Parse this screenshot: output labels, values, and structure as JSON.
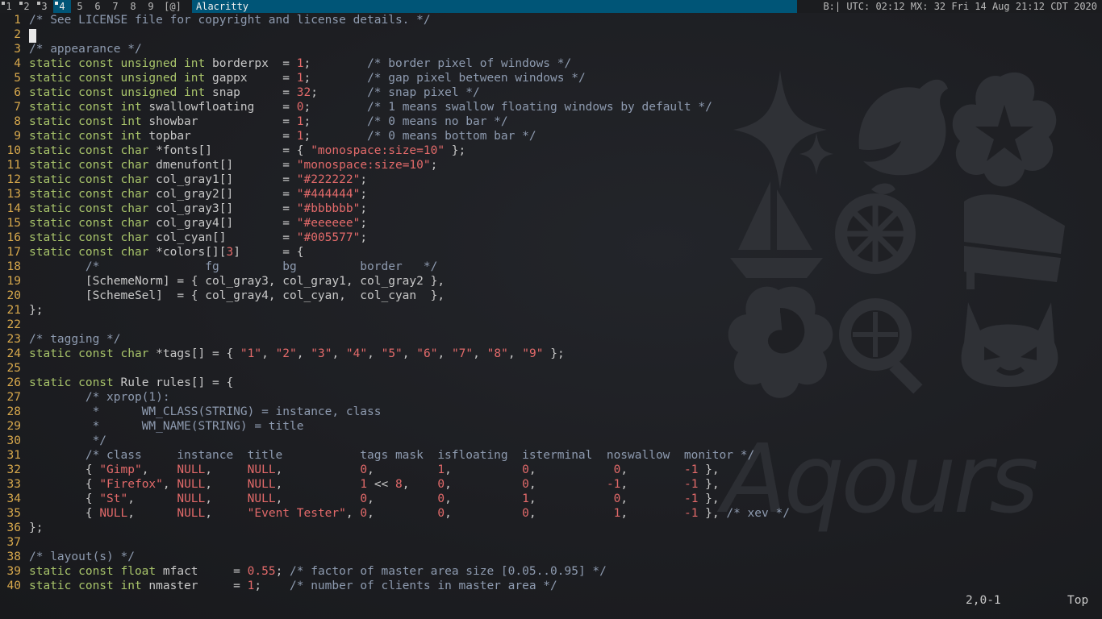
{
  "bar": {
    "tags": [
      {
        "label": "1",
        "occupied": true,
        "selected": false
      },
      {
        "label": "2",
        "occupied": true,
        "selected": false
      },
      {
        "label": "3",
        "occupied": true,
        "selected": false
      },
      {
        "label": "4",
        "occupied": true,
        "selected": true
      },
      {
        "label": "5",
        "occupied": false,
        "selected": false
      },
      {
        "label": "6",
        "occupied": false,
        "selected": false
      },
      {
        "label": "7",
        "occupied": false,
        "selected": false
      },
      {
        "label": "8",
        "occupied": false,
        "selected": false
      },
      {
        "label": "9",
        "occupied": false,
        "selected": false
      }
    ],
    "layout_symbol": "[@]",
    "window_title": "Alacritty",
    "status_text": "B:| UTC: 02:12 MX: 32 Fri 14 Aug 21:12 CDT 2020"
  },
  "editor": {
    "lines": [
      [
        [
          "cm",
          "/* See LICENSE file for copyright and license details. */"
        ]
      ],
      [],
      [
        [
          "cm",
          "/* appearance */"
        ]
      ],
      [
        [
          "kw",
          "static const unsigned int "
        ],
        [
          "tx",
          "borderpx  = "
        ],
        [
          "nm",
          "1"
        ],
        [
          "tx",
          ";        "
        ],
        [
          "cm",
          "/* border pixel of windows */"
        ]
      ],
      [
        [
          "kw",
          "static const unsigned int "
        ],
        [
          "tx",
          "gappx     = "
        ],
        [
          "nm",
          "1"
        ],
        [
          "tx",
          ";        "
        ],
        [
          "cm",
          "/* gap pixel between windows */"
        ]
      ],
      [
        [
          "kw",
          "static const unsigned int "
        ],
        [
          "tx",
          "snap      = "
        ],
        [
          "nm",
          "32"
        ],
        [
          "tx",
          ";       "
        ],
        [
          "cm",
          "/* snap pixel */"
        ]
      ],
      [
        [
          "kw",
          "static const int "
        ],
        [
          "tx",
          "swallowfloating    = "
        ],
        [
          "nm",
          "0"
        ],
        [
          "tx",
          ";        "
        ],
        [
          "cm",
          "/* 1 means swallow floating windows by default */"
        ]
      ],
      [
        [
          "kw",
          "static const int "
        ],
        [
          "tx",
          "showbar            = "
        ],
        [
          "nm",
          "1"
        ],
        [
          "tx",
          ";        "
        ],
        [
          "cm",
          "/* 0 means no bar */"
        ]
      ],
      [
        [
          "kw",
          "static const int "
        ],
        [
          "tx",
          "topbar             = "
        ],
        [
          "nm",
          "1"
        ],
        [
          "tx",
          ";        "
        ],
        [
          "cm",
          "/* 0 means bottom bar */"
        ]
      ],
      [
        [
          "kw",
          "static const char "
        ],
        [
          "tx",
          "*fonts[]          = { "
        ],
        [
          "st",
          "\"monospace:size=10\""
        ],
        [
          "tx",
          " };"
        ]
      ],
      [
        [
          "kw",
          "static const char "
        ],
        [
          "tx",
          "dmenufont[]       = "
        ],
        [
          "st",
          "\"monospace:size=10\""
        ],
        [
          "tx",
          ";"
        ]
      ],
      [
        [
          "kw",
          "static const char "
        ],
        [
          "tx",
          "col_gray1[]       = "
        ],
        [
          "st",
          "\"#222222\""
        ],
        [
          "tx",
          ";"
        ]
      ],
      [
        [
          "kw",
          "static const char "
        ],
        [
          "tx",
          "col_gray2[]       = "
        ],
        [
          "st",
          "\"#444444\""
        ],
        [
          "tx",
          ";"
        ]
      ],
      [
        [
          "kw",
          "static const char "
        ],
        [
          "tx",
          "col_gray3[]       = "
        ],
        [
          "st",
          "\"#bbbbbb\""
        ],
        [
          "tx",
          ";"
        ]
      ],
      [
        [
          "kw",
          "static const char "
        ],
        [
          "tx",
          "col_gray4[]       = "
        ],
        [
          "st",
          "\"#eeeeee\""
        ],
        [
          "tx",
          ";"
        ]
      ],
      [
        [
          "kw",
          "static const char "
        ],
        [
          "tx",
          "col_cyan[]        = "
        ],
        [
          "st",
          "\"#005577\""
        ],
        [
          "tx",
          ";"
        ]
      ],
      [
        [
          "kw",
          "static const char "
        ],
        [
          "tx",
          "*colors[]["
        ],
        [
          "nm",
          "3"
        ],
        [
          "tx",
          "]      = {"
        ]
      ],
      [
        [
          "tx",
          "        "
        ],
        [
          "cm",
          "/*               fg         bg         border   */"
        ]
      ],
      [
        [
          "tx",
          "        [SchemeNorm] = { col_gray3, col_gray1, col_gray2 },"
        ]
      ],
      [
        [
          "tx",
          "        [SchemeSel]  = { col_gray4, col_cyan,  col_cyan  },"
        ]
      ],
      [
        [
          "tx",
          "};"
        ]
      ],
      [],
      [
        [
          "cm",
          "/* tagging */"
        ]
      ],
      [
        [
          "kw",
          "static const char "
        ],
        [
          "tx",
          "*tags[] = { "
        ],
        [
          "st",
          "\"1\""
        ],
        [
          "tx",
          ", "
        ],
        [
          "st",
          "\"2\""
        ],
        [
          "tx",
          ", "
        ],
        [
          "st",
          "\"3\""
        ],
        [
          "tx",
          ", "
        ],
        [
          "st",
          "\"4\""
        ],
        [
          "tx",
          ", "
        ],
        [
          "st",
          "\"5\""
        ],
        [
          "tx",
          ", "
        ],
        [
          "st",
          "\"6\""
        ],
        [
          "tx",
          ", "
        ],
        [
          "st",
          "\"7\""
        ],
        [
          "tx",
          ", "
        ],
        [
          "st",
          "\"8\""
        ],
        [
          "tx",
          ", "
        ],
        [
          "st",
          "\"9\""
        ],
        [
          "tx",
          " };"
        ]
      ],
      [],
      [
        [
          "kw",
          "static const "
        ],
        [
          "tx",
          "Rule rules[] = {"
        ]
      ],
      [
        [
          "tx",
          "        "
        ],
        [
          "cm",
          "/* xprop(1):"
        ]
      ],
      [
        [
          "cm",
          "         *      WM_CLASS(STRING) = instance, class"
        ]
      ],
      [
        [
          "cm",
          "         *      WM_NAME(STRING) = title"
        ]
      ],
      [
        [
          "cm",
          "         */"
        ]
      ],
      [
        [
          "tx",
          "        "
        ],
        [
          "cm",
          "/* class     instance  title           tags mask  isfloating  isterminal  noswallow  monitor */"
        ]
      ],
      [
        [
          "tx",
          "        { "
        ],
        [
          "st",
          "\"Gimp\""
        ],
        [
          "tx",
          ",    "
        ],
        [
          "nm",
          "NULL"
        ],
        [
          "tx",
          ",     "
        ],
        [
          "nm",
          "NULL"
        ],
        [
          "tx",
          ",           "
        ],
        [
          "nm",
          "0"
        ],
        [
          "tx",
          ",         "
        ],
        [
          "nm",
          "1"
        ],
        [
          "tx",
          ",          "
        ],
        [
          "nm",
          "0"
        ],
        [
          "tx",
          ",           "
        ],
        [
          "nm",
          "0"
        ],
        [
          "tx",
          ",        "
        ],
        [
          "nm",
          "-1"
        ],
        [
          "tx",
          " },"
        ]
      ],
      [
        [
          "tx",
          "        { "
        ],
        [
          "st",
          "\"Firefox\""
        ],
        [
          "tx",
          ", "
        ],
        [
          "nm",
          "NULL"
        ],
        [
          "tx",
          ",     "
        ],
        [
          "nm",
          "NULL"
        ],
        [
          "tx",
          ",           "
        ],
        [
          "nm",
          "1"
        ],
        [
          "tx",
          " << "
        ],
        [
          "nm",
          "8"
        ],
        [
          "tx",
          ",    "
        ],
        [
          "nm",
          "0"
        ],
        [
          "tx",
          ",          "
        ],
        [
          "nm",
          "0"
        ],
        [
          "tx",
          ",          "
        ],
        [
          "nm",
          "-1"
        ],
        [
          "tx",
          ",        "
        ],
        [
          "nm",
          "-1"
        ],
        [
          "tx",
          " },"
        ]
      ],
      [
        [
          "tx",
          "        { "
        ],
        [
          "st",
          "\"St\""
        ],
        [
          "tx",
          ",      "
        ],
        [
          "nm",
          "NULL"
        ],
        [
          "tx",
          ",     "
        ],
        [
          "nm",
          "NULL"
        ],
        [
          "tx",
          ",           "
        ],
        [
          "nm",
          "0"
        ],
        [
          "tx",
          ",         "
        ],
        [
          "nm",
          "0"
        ],
        [
          "tx",
          ",          "
        ],
        [
          "nm",
          "1"
        ],
        [
          "tx",
          ",           "
        ],
        [
          "nm",
          "0"
        ],
        [
          "tx",
          ",        "
        ],
        [
          "nm",
          "-1"
        ],
        [
          "tx",
          " },"
        ]
      ],
      [
        [
          "tx",
          "        { "
        ],
        [
          "nm",
          "NULL"
        ],
        [
          "tx",
          ",      "
        ],
        [
          "nm",
          "NULL"
        ],
        [
          "tx",
          ",     "
        ],
        [
          "st",
          "\"Event Tester\""
        ],
        [
          "tx",
          ", "
        ],
        [
          "nm",
          "0"
        ],
        [
          "tx",
          ",         "
        ],
        [
          "nm",
          "0"
        ],
        [
          "tx",
          ",          "
        ],
        [
          "nm",
          "0"
        ],
        [
          "tx",
          ",           "
        ],
        [
          "nm",
          "1"
        ],
        [
          "tx",
          ",        "
        ],
        [
          "nm",
          "-1"
        ],
        [
          "tx",
          " }, "
        ],
        [
          "cm",
          "/* xev */"
        ]
      ],
      [
        [
          "tx",
          "};"
        ]
      ],
      [],
      [
        [
          "cm",
          "/* layout(s) */"
        ]
      ],
      [
        [
          "kw",
          "static const float "
        ],
        [
          "tx",
          "mfact     = "
        ],
        [
          "nm",
          "0.55"
        ],
        [
          "tx",
          "; "
        ],
        [
          "cm",
          "/* factor of master area size [0.05..0.95] */"
        ]
      ],
      [
        [
          "kw",
          "static const int "
        ],
        [
          "tx",
          "nmaster     = "
        ],
        [
          "nm",
          "1"
        ],
        [
          "tx",
          ";    "
        ],
        [
          "cm",
          "/* number of clients in master area */"
        ]
      ]
    ],
    "ruler": "2,0-1",
    "scroll_position": "Top"
  },
  "wallpaper": {
    "text": "Aqours",
    "icons": [
      "sparkle-icon",
      "dolphin-icon",
      "sakura-icon",
      "sailboat-icon",
      "orange-slice-icon",
      "piano-icon",
      "flower-swirl-icon",
      "magnifier-icon",
      "devil-icon"
    ]
  },
  "colors": {
    "bar_bg": "#1b1c1f",
    "selected": "#005577",
    "keyword": "#a8c46a",
    "comment": "#8e9bb0",
    "string": "#e36a6a",
    "line_number": "#d7a84c"
  }
}
